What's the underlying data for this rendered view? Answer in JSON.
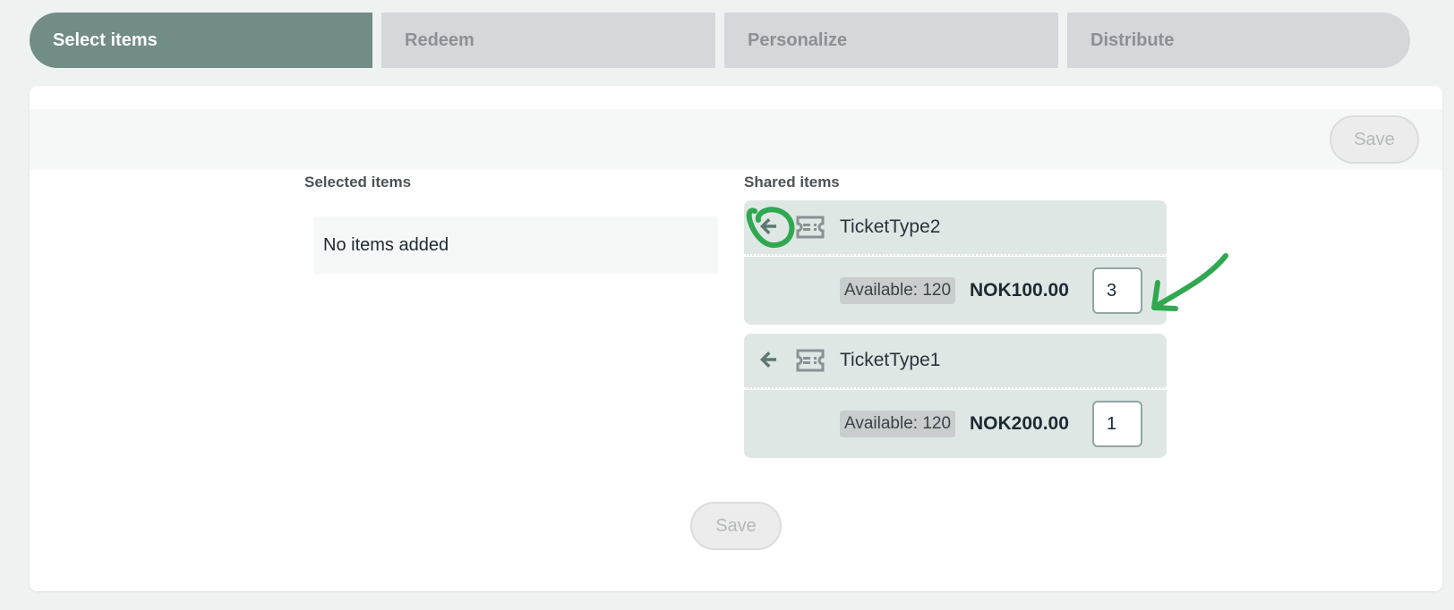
{
  "steps": [
    {
      "label": "Select items",
      "active": true
    },
    {
      "label": "Redeem",
      "active": false
    },
    {
      "label": "Personalize",
      "active": false
    },
    {
      "label": "Distribute",
      "active": false
    }
  ],
  "toolbar": {
    "save_label": "Save"
  },
  "selected": {
    "title": "Selected items",
    "empty_text": "No items added"
  },
  "shared": {
    "title": "Shared items",
    "items": [
      {
        "name": "TicketType2",
        "available": "Available: 120",
        "price": "NOK100.00",
        "quantity": "3"
      },
      {
        "name": "TicketType1",
        "available": "Available: 120",
        "price": "NOK200.00",
        "quantity": "1"
      }
    ]
  },
  "footer": {
    "save_label": "Save"
  },
  "colors": {
    "active_step": "#728c86",
    "inactive_step": "#d5d7da",
    "item_bg": "#dfe7e5",
    "annotation": "#2fa84f"
  },
  "icons": {
    "back": "arrow-left-icon",
    "ticket": "ticket-icon"
  }
}
